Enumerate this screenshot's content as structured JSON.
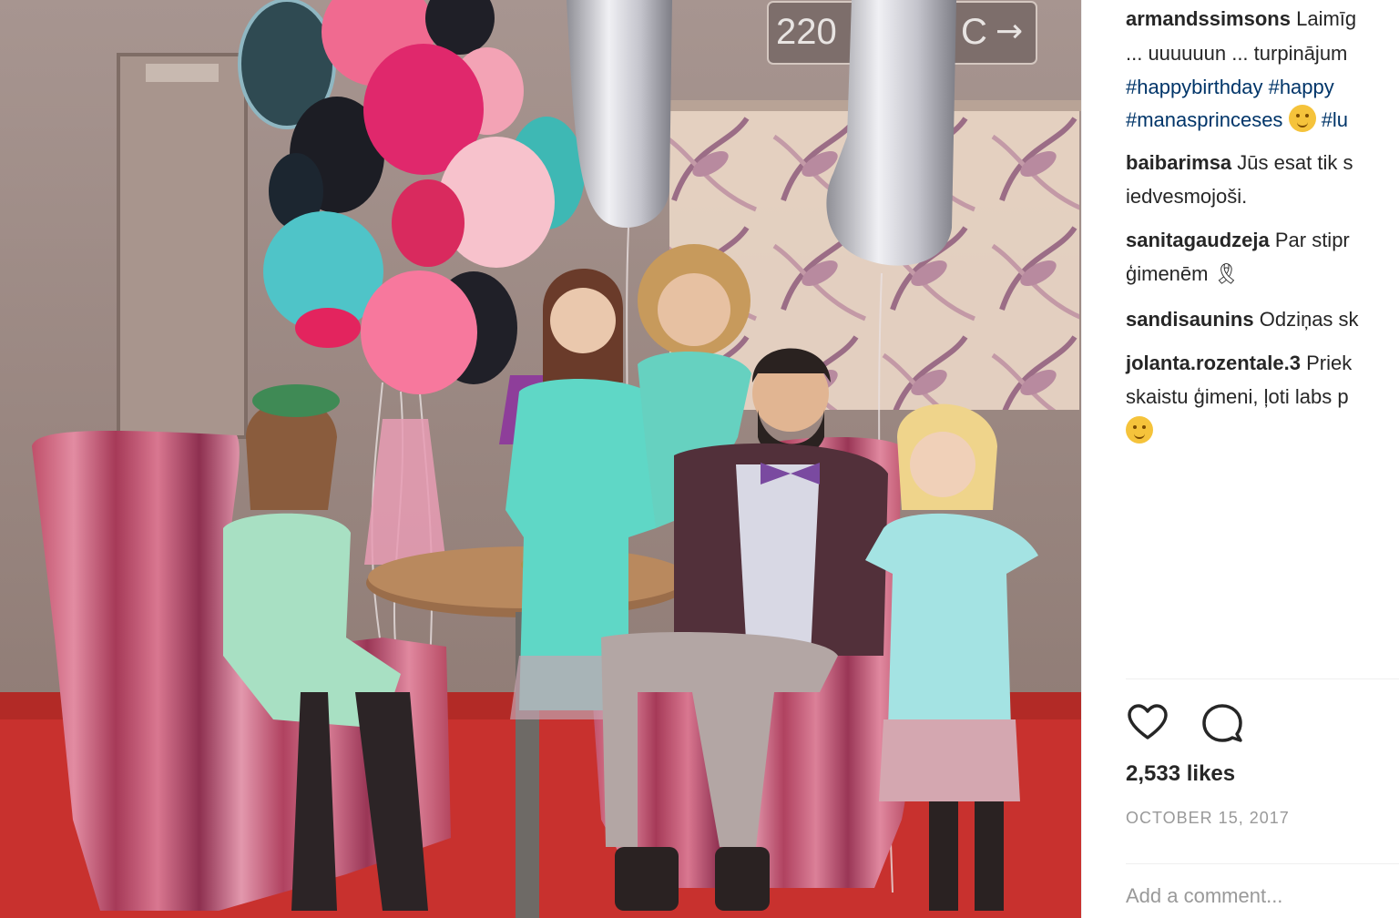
{
  "post": {
    "caption": {
      "user": "armandssimsons",
      "line1_text": "Laimīg",
      "line2_text": "... uuuuuun ... turpinājum",
      "line3_tag1": "#happybirthday",
      "line3_tag2": "#happy",
      "line4_tag1": "#manasprinceses",
      "line4_tag2": "#lu"
    },
    "comments": [
      {
        "user": "baibarimsa",
        "text": "Jūs esat tik s",
        "text2": "iedvesmojoši."
      },
      {
        "user": "sanitagaudzeja",
        "text": "Par stipr",
        "text2": "ģimenēm"
      },
      {
        "user": "sandisaunins",
        "text": "Odziņas sk"
      },
      {
        "user": "jolanta.rozentale.3",
        "text": "Priek",
        "text2": "skaistu ģimeni, ļoti labs p"
      }
    ],
    "likes": "2,533 likes",
    "date": "OCTOBER 15, 2017",
    "add_comment_placeholder": "Add a comment..."
  },
  "photo": {
    "sign_text": "220",
    "sign_suffix": "C",
    "icons": {
      "like": "heart-icon",
      "comment": "comment-bubble-icon",
      "emoji": "smiling-face-emoji",
      "ribbon": "black-ribbon-emoji"
    }
  },
  "colors": {
    "hashtag": "#003569",
    "text": "#262626",
    "muted": "#999999"
  }
}
